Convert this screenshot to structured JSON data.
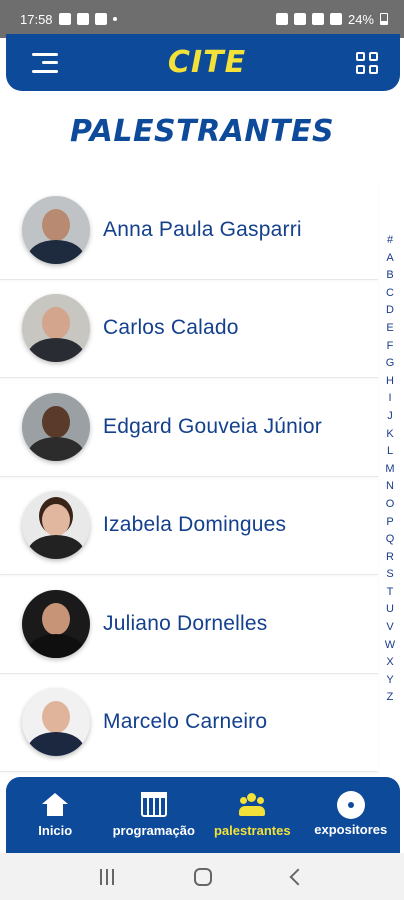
{
  "status_bar": {
    "time": "17:58",
    "battery": "24%"
  },
  "header": {
    "brand": "CITE",
    "menu_icon": "hamburger-menu-icon",
    "qr_icon": "qr-code-icon",
    "brand_color": "#f3e13a",
    "background_color": "#0d4a9a"
  },
  "page": {
    "title": "PALESTRANTES"
  },
  "speakers": [
    {
      "name": "Anna Paula Gasparri"
    },
    {
      "name": "Carlos Calado"
    },
    {
      "name": "Edgard Gouveia Júnior"
    },
    {
      "name": "Izabela Domingues"
    },
    {
      "name": "Juliano Dornelles"
    },
    {
      "name": "Marcelo Carneiro"
    }
  ],
  "alphabet_index": [
    "#",
    "A",
    "B",
    "C",
    "D",
    "E",
    "F",
    "G",
    "H",
    "I",
    "J",
    "K",
    "L",
    "M",
    "N",
    "O",
    "P",
    "Q",
    "R",
    "S",
    "T",
    "U",
    "V",
    "W",
    "X",
    "Y",
    "Z"
  ],
  "bottom_nav": {
    "items": [
      {
        "label": "Inicio",
        "icon": "home-icon",
        "active": false
      },
      {
        "label": "programação",
        "icon": "calendar-icon",
        "active": false
      },
      {
        "label": "palestrantes",
        "icon": "people-icon",
        "active": true
      },
      {
        "label": "expositores",
        "icon": "badge-icon",
        "active": false
      }
    ],
    "active_color": "#f3e13a"
  }
}
